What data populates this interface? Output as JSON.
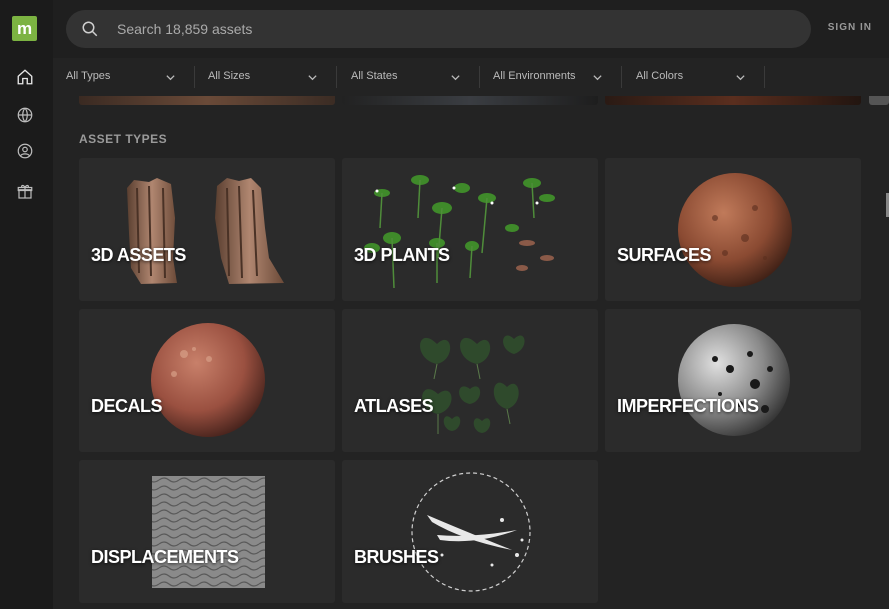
{
  "logo": {
    "letter": "m",
    "color": "#7cb342"
  },
  "sidebar": {
    "items": [
      {
        "name": "home",
        "icon": "home-icon"
      },
      {
        "name": "browse",
        "icon": "globe-icon"
      },
      {
        "name": "account",
        "icon": "user-circle-icon"
      },
      {
        "name": "gifts",
        "icon": "gift-icon"
      }
    ]
  },
  "search": {
    "placeholder": "Search 18,859 assets"
  },
  "header": {
    "signin_label": "SIGN IN"
  },
  "filters": [
    {
      "label": "All Types"
    },
    {
      "label": "All Sizes"
    },
    {
      "label": "All States"
    },
    {
      "label": "All Environments"
    },
    {
      "label": "All Colors"
    }
  ],
  "section": {
    "title": "ASSET TYPES"
  },
  "cards": [
    {
      "label": "3D ASSETS"
    },
    {
      "label": "3D PLANTS"
    },
    {
      "label": "SURFACES"
    },
    {
      "label": "DECALS"
    },
    {
      "label": "ATLASES"
    },
    {
      "label": "IMPERFECTIONS"
    },
    {
      "label": "DISPLACEMENTS"
    },
    {
      "label": "BRUSHES"
    }
  ]
}
